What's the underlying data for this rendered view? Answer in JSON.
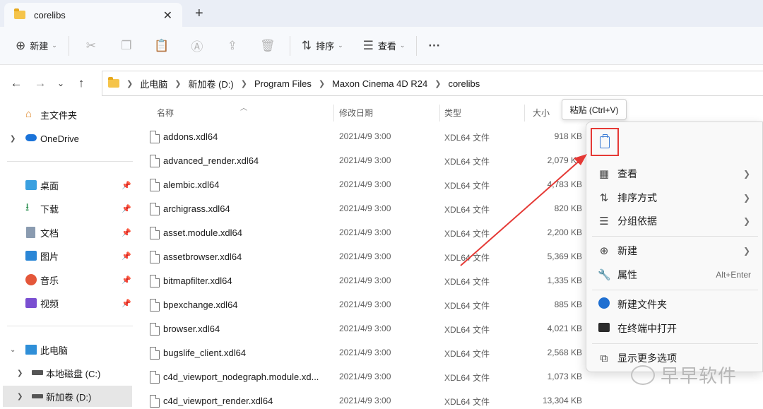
{
  "tab": {
    "title": "corelibs",
    "close": "✕",
    "new": "+"
  },
  "toolbar": {
    "new_label": "新建",
    "sort_label": "排序",
    "view_label": "查看",
    "more": "···"
  },
  "address": {
    "crumbs": [
      "此电脑",
      "新加卷 (D:)",
      "Program Files",
      "Maxon Cinema 4D R24",
      "corelibs"
    ]
  },
  "sidebar": {
    "home": "主文件夹",
    "onedrive": "OneDrive",
    "desktop": "桌面",
    "downloads": "下载",
    "documents": "文档",
    "pictures": "图片",
    "music": "音乐",
    "videos": "视频",
    "thispc": "此电脑",
    "localdisk": "本地磁盘 (C:)",
    "newvolume": "新加卷 (D:)"
  },
  "columns": {
    "name": "名称",
    "date": "修改日期",
    "type": "类型",
    "size": "大小"
  },
  "files": [
    {
      "name": "addons.xdl64",
      "date": "2021/4/9 3:00",
      "type": "XDL64 文件",
      "size": "918 KB"
    },
    {
      "name": "advanced_render.xdl64",
      "date": "2021/4/9 3:00",
      "type": "XDL64 文件",
      "size": "2,079 KB"
    },
    {
      "name": "alembic.xdl64",
      "date": "2021/4/9 3:00",
      "type": "XDL64 文件",
      "size": "4,783 KB"
    },
    {
      "name": "archigrass.xdl64",
      "date": "2021/4/9 3:00",
      "type": "XDL64 文件",
      "size": "820 KB"
    },
    {
      "name": "asset.module.xdl64",
      "date": "2021/4/9 3:00",
      "type": "XDL64 文件",
      "size": "2,200 KB"
    },
    {
      "name": "assetbrowser.xdl64",
      "date": "2021/4/9 3:00",
      "type": "XDL64 文件",
      "size": "5,369 KB"
    },
    {
      "name": "bitmapfilter.xdl64",
      "date": "2021/4/9 3:00",
      "type": "XDL64 文件",
      "size": "1,335 KB"
    },
    {
      "name": "bpexchange.xdl64",
      "date": "2021/4/9 3:00",
      "type": "XDL64 文件",
      "size": "885 KB"
    },
    {
      "name": "browser.xdl64",
      "date": "2021/4/9 3:00",
      "type": "XDL64 文件",
      "size": "4,021 KB"
    },
    {
      "name": "bugslife_client.xdl64",
      "date": "2021/4/9 3:00",
      "type": "XDL64 文件",
      "size": "2,568 KB"
    },
    {
      "name": "c4d_viewport_nodegraph.module.xd...",
      "date": "2021/4/9 3:00",
      "type": "XDL64 文件",
      "size": "1,073 KB"
    },
    {
      "name": "c4d_viewport_render.xdl64",
      "date": "2021/4/9 3:00",
      "type": "XDL64 文件",
      "size": "13,304 KB"
    }
  ],
  "tooltip": "粘贴 (Ctrl+V)",
  "context_menu": {
    "view": "查看",
    "sort": "排序方式",
    "group": "分组依据",
    "new": "新建",
    "properties": "属性",
    "properties_shortcut": "Alt+Enter",
    "new_folder": "新建文件夹",
    "terminal": "在终端中打开",
    "more_options": "显示更多选项"
  },
  "watermark": "早早软件",
  "colors": {
    "highlight_border": "#e53935",
    "arrow": "#e53935",
    "accent": "#1f6fd1"
  }
}
